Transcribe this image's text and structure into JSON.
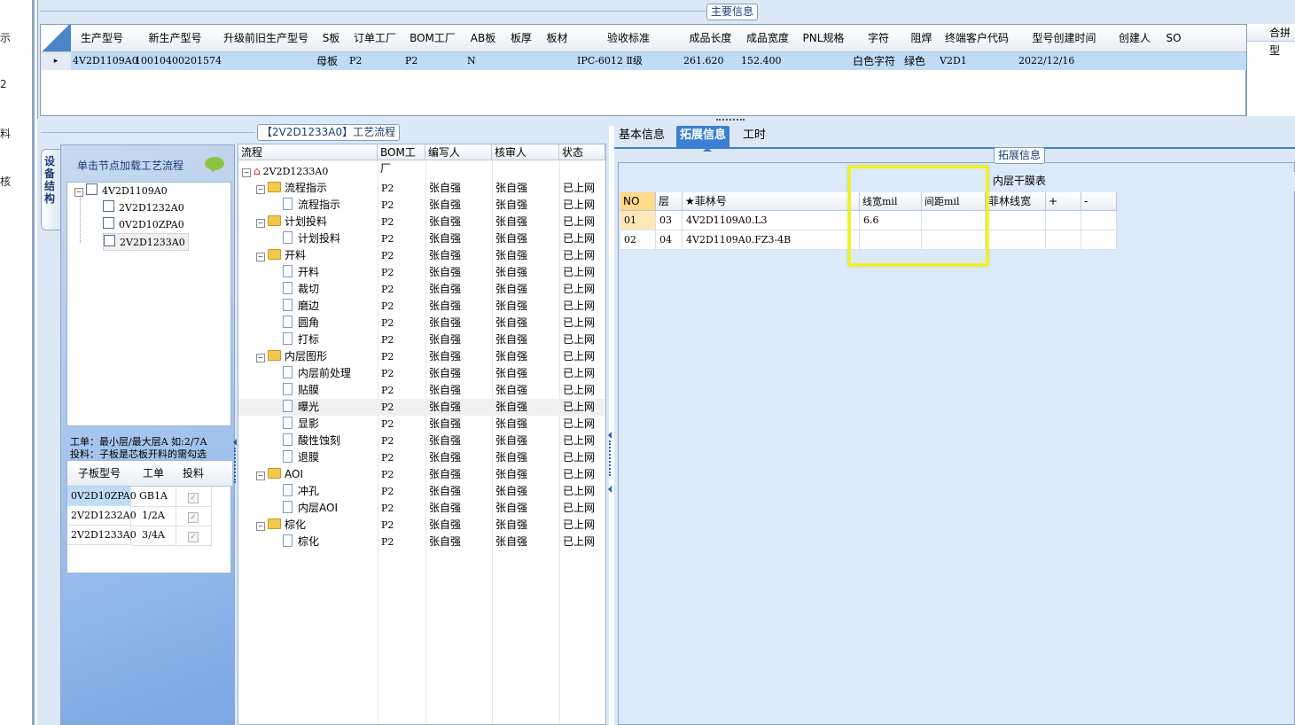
{
  "left_stub": [
    "示",
    "2",
    "料",
    "核"
  ],
  "main_info": {
    "title": "主要信息",
    "columns": [
      "生产型号",
      "新生产型号",
      "升级前旧生产型号",
      "S板",
      "订单工厂",
      "BOM工厂",
      "AB板",
      "板厚",
      "板材",
      "验收标准",
      "成品长度",
      "成品宽度",
      "PNL规格",
      "字符",
      "阻焊",
      "终端客户代码",
      "型号创建时间",
      "创建人",
      "SO"
    ],
    "row": {
      "marker": "▸",
      "prod_model": "4V2D1109A0",
      "new_model": "10010400201574",
      "board_type": "母板",
      "order_factory": "P2",
      "bom_factory": "P2",
      "ab": "N",
      "standard": "IPC-6012 Ⅱ级",
      "length": "261.620",
      "width": "152.400",
      "char": "白色字符",
      "solder": "绿色",
      "customer": "V2D1",
      "created": "2022/12/16"
    },
    "merge_label": "合拼型"
  },
  "structure": {
    "vtab_label": "设备结构",
    "hint": "单击节点加载工艺流程",
    "tree": [
      "4V2D1109A0",
      "2V2D1232A0",
      "0V2D10ZPA0",
      "2V2D1233A0"
    ],
    "note_line1": "工单：最小层/最大层A 如:2/7A",
    "note_line2": "投料：子板是芯板开料的需勾选",
    "sub_headers": [
      "子板型号",
      "工单",
      "投料"
    ],
    "sub_rows": [
      {
        "model": "0V2D10ZPA0",
        "order": "GB1A",
        "checked": "✓"
      },
      {
        "model": "2V2D1232A0",
        "order": "1/2A",
        "checked": "✓"
      },
      {
        "model": "2V2D1233A0",
        "order": "3/4A",
        "checked": "✓"
      }
    ]
  },
  "process": {
    "title": "【2V2D1233A0】工艺流程",
    "headers": [
      "流程",
      "BOM工厂",
      "编写人",
      "核审人",
      "状态"
    ],
    "root": "2V2D1233A0",
    "rows": [
      {
        "label": "流程指示",
        "level": 1,
        "folder": true
      },
      {
        "label": "流程指示",
        "level": 2,
        "folder": false
      },
      {
        "label": "计划投料",
        "level": 1,
        "folder": true
      },
      {
        "label": "计划投料",
        "level": 2,
        "folder": false
      },
      {
        "label": "开料",
        "level": 1,
        "folder": true
      },
      {
        "label": "开料",
        "level": 2,
        "folder": false
      },
      {
        "label": "裁切",
        "level": 2,
        "folder": false
      },
      {
        "label": "磨边",
        "level": 2,
        "folder": false
      },
      {
        "label": "圆角",
        "level": 2,
        "folder": false
      },
      {
        "label": "打标",
        "level": 2,
        "folder": false
      },
      {
        "label": "内层图形",
        "level": 1,
        "folder": true
      },
      {
        "label": "内层前处理",
        "level": 2,
        "folder": false
      },
      {
        "label": "贴膜",
        "level": 2,
        "folder": false
      },
      {
        "label": "曝光",
        "level": 2,
        "folder": false
      },
      {
        "label": "显影",
        "level": 2,
        "folder": false
      },
      {
        "label": "酸性蚀刻",
        "level": 2,
        "folder": false
      },
      {
        "label": "退膜",
        "level": 2,
        "folder": false
      },
      {
        "label": "AOI",
        "level": 1,
        "folder": true
      },
      {
        "label": "冲孔",
        "level": 2,
        "folder": false
      },
      {
        "label": "内层AOI",
        "level": 2,
        "folder": false
      },
      {
        "label": "棕化",
        "level": 1,
        "folder": true
      },
      {
        "label": "棕化",
        "level": 2,
        "folder": false
      }
    ],
    "bom": "P2",
    "writer": "张自强",
    "reviewer": "张自强",
    "status": "已上网",
    "selected_label": "曝光"
  },
  "tabs": [
    "基本信息",
    "拓展信息",
    "工时"
  ],
  "active_tab": "拓展信息",
  "extended": {
    "title": "拓展信息",
    "group_title": "内层干膜表",
    "headers": [
      "NO",
      "层",
      "★菲林号",
      "线宽mil",
      "间距mil",
      "菲林线宽",
      "+",
      "-"
    ],
    "rows": [
      {
        "no": "01",
        "layer": "03",
        "film": "4V2D1109A0.L3",
        "width": "6.6",
        "spacing": "",
        "film_width": ""
      },
      {
        "no": "02",
        "layer": "04",
        "film": "4V2D1109A0.FZ3-4B",
        "width": "",
        "spacing": "",
        "film_width": ""
      }
    ]
  },
  "colors": {
    "panel_bg": "#dce8f6",
    "selected_row": "#bfdcf7",
    "active_tab": "#3c7fd5",
    "highlight": "#f2f21a"
  }
}
